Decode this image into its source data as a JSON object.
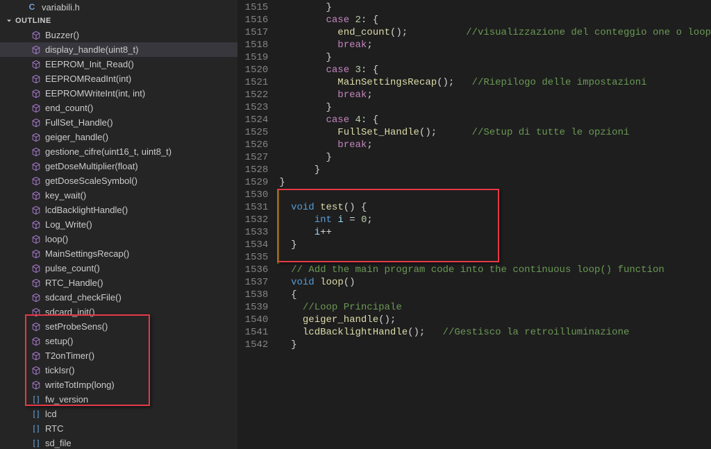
{
  "file": {
    "name": "variabili.h",
    "iconLetter": "C"
  },
  "outlineTitle": "OUTLINE",
  "outline": [
    {
      "label": "Buzzer()",
      "icon": "cube",
      "sel": false
    },
    {
      "label": "display_handle(uint8_t)",
      "icon": "cube",
      "sel": true
    },
    {
      "label": "EEPROM_Init_Read()",
      "icon": "cube",
      "sel": false
    },
    {
      "label": "EEPROMReadInt(int)",
      "icon": "cube",
      "sel": false
    },
    {
      "label": "EEPROMWriteInt(int, int)",
      "icon": "cube",
      "sel": false
    },
    {
      "label": "end_count()",
      "icon": "cube",
      "sel": false
    },
    {
      "label": "FullSet_Handle()",
      "icon": "cube",
      "sel": false
    },
    {
      "label": "geiger_handle()",
      "icon": "cube",
      "sel": false
    },
    {
      "label": "gestione_cifre(uint16_t, uint8_t)",
      "icon": "cube",
      "sel": false
    },
    {
      "label": "getDoseMultiplier(float)",
      "icon": "cube",
      "sel": false
    },
    {
      "label": "getDoseScaleSymbol()",
      "icon": "cube",
      "sel": false
    },
    {
      "label": "key_wait()",
      "icon": "cube",
      "sel": false
    },
    {
      "label": "lcdBacklightHandle()",
      "icon": "cube",
      "sel": false
    },
    {
      "label": "Log_Write()",
      "icon": "cube",
      "sel": false
    },
    {
      "label": "loop()",
      "icon": "cube",
      "sel": false
    },
    {
      "label": "MainSettingsRecap()",
      "icon": "cube",
      "sel": false
    },
    {
      "label": "pulse_count()",
      "icon": "cube",
      "sel": false
    },
    {
      "label": "RTC_Handle()",
      "icon": "cube",
      "sel": false
    },
    {
      "label": "sdcard_checkFile()",
      "icon": "cube",
      "sel": false
    },
    {
      "label": "sdcard_init()",
      "icon": "cube",
      "sel": false
    },
    {
      "label": "setProbeSens()",
      "icon": "cube",
      "sel": false
    },
    {
      "label": "setup()",
      "icon": "cube",
      "sel": false
    },
    {
      "label": "T2onTimer()",
      "icon": "cube",
      "sel": false
    },
    {
      "label": "tickIsr()",
      "icon": "cube",
      "sel": false
    },
    {
      "label": "writeTotImp(long)",
      "icon": "cube",
      "sel": false
    },
    {
      "label": "fw_version",
      "icon": "bracket",
      "sel": false
    },
    {
      "label": "lcd",
      "icon": "bracket",
      "sel": false
    },
    {
      "label": "RTC",
      "icon": "bracket",
      "sel": false
    },
    {
      "label": "sd_file",
      "icon": "bracket",
      "sel": false
    }
  ],
  "lineStart": 1515,
  "code": [
    [
      {
        "t": "        }",
        "c": "op"
      }
    ],
    [
      {
        "t": "        ",
        "c": "op"
      },
      {
        "t": "case",
        "c": "kw"
      },
      {
        "t": " ",
        "c": "op"
      },
      {
        "t": "2",
        "c": "num"
      },
      {
        "t": ": {",
        "c": "op"
      }
    ],
    [
      {
        "t": "          ",
        "c": "op"
      },
      {
        "t": "end_count",
        "c": "fn"
      },
      {
        "t": "();          ",
        "c": "op"
      },
      {
        "t": "//visualizzazione del conteggio one o loop",
        "c": "cmt"
      }
    ],
    [
      {
        "t": "          ",
        "c": "op"
      },
      {
        "t": "break",
        "c": "kw"
      },
      {
        "t": ";",
        "c": "op"
      }
    ],
    [
      {
        "t": "        }",
        "c": "op"
      }
    ],
    [
      {
        "t": "        ",
        "c": "op"
      },
      {
        "t": "case",
        "c": "kw"
      },
      {
        "t": " ",
        "c": "op"
      },
      {
        "t": "3",
        "c": "num"
      },
      {
        "t": ": {",
        "c": "op"
      }
    ],
    [
      {
        "t": "          ",
        "c": "op"
      },
      {
        "t": "MainSettingsRecap",
        "c": "fn"
      },
      {
        "t": "();   ",
        "c": "op"
      },
      {
        "t": "//Riepilogo delle impostazioni",
        "c": "cmt"
      }
    ],
    [
      {
        "t": "          ",
        "c": "op"
      },
      {
        "t": "break",
        "c": "kw"
      },
      {
        "t": ";",
        "c": "op"
      }
    ],
    [
      {
        "t": "        }",
        "c": "op"
      }
    ],
    [
      {
        "t": "        ",
        "c": "op"
      },
      {
        "t": "case",
        "c": "kw"
      },
      {
        "t": " ",
        "c": "op"
      },
      {
        "t": "4",
        "c": "num"
      },
      {
        "t": ": {",
        "c": "op"
      }
    ],
    [
      {
        "t": "          ",
        "c": "op"
      },
      {
        "t": "FullSet_Handle",
        "c": "fn"
      },
      {
        "t": "();      ",
        "c": "op"
      },
      {
        "t": "//Setup di tutte le opzioni",
        "c": "cmt"
      }
    ],
    [
      {
        "t": "          ",
        "c": "op"
      },
      {
        "t": "break",
        "c": "kw"
      },
      {
        "t": ";",
        "c": "op"
      }
    ],
    [
      {
        "t": "        }",
        "c": "op"
      }
    ],
    [
      {
        "t": "      }",
        "c": "op"
      }
    ],
    [
      {
        "t": "}",
        "c": "op"
      }
    ],
    [],
    [
      {
        "t": "  ",
        "c": "op"
      },
      {
        "t": "void",
        "c": "type"
      },
      {
        "t": " ",
        "c": "op"
      },
      {
        "t": "test",
        "c": "fn"
      },
      {
        "t": "() {",
        "c": "op"
      }
    ],
    [
      {
        "t": "      ",
        "c": "op"
      },
      {
        "t": "int",
        "c": "type"
      },
      {
        "t": " ",
        "c": "op"
      },
      {
        "t": "i",
        "c": "var"
      },
      {
        "t": " = ",
        "c": "op"
      },
      {
        "t": "0",
        "c": "num"
      },
      {
        "t": ";",
        "c": "op"
      }
    ],
    [
      {
        "t": "      ",
        "c": "op"
      },
      {
        "t": "i",
        "c": "var"
      },
      {
        "t": "++",
        "c": "op"
      }
    ],
    [
      {
        "t": "  }",
        "c": "op"
      }
    ],
    [],
    [
      {
        "t": "  ",
        "c": "op"
      },
      {
        "t": "// Add the main program code into the continuous loop() function",
        "c": "cmt"
      }
    ],
    [
      {
        "t": "  ",
        "c": "op"
      },
      {
        "t": "void",
        "c": "type"
      },
      {
        "t": " ",
        "c": "op"
      },
      {
        "t": "loop",
        "c": "fn"
      },
      {
        "t": "()",
        "c": "op"
      }
    ],
    [
      {
        "t": "  {",
        "c": "op"
      }
    ],
    [
      {
        "t": "    ",
        "c": "op"
      },
      {
        "t": "//Loop Principale",
        "c": "cmt"
      }
    ],
    [
      {
        "t": "    ",
        "c": "op"
      },
      {
        "t": "geiger_handle",
        "c": "fn"
      },
      {
        "t": "();",
        "c": "op"
      }
    ],
    [
      {
        "t": "    ",
        "c": "op"
      },
      {
        "t": "lcdBacklightHandle",
        "c": "fn"
      },
      {
        "t": "();   ",
        "c": "op"
      },
      {
        "t": "//Gestisco la retroilluminazione",
        "c": "cmt"
      }
    ],
    [
      {
        "t": "  }",
        "c": "op"
      }
    ]
  ]
}
